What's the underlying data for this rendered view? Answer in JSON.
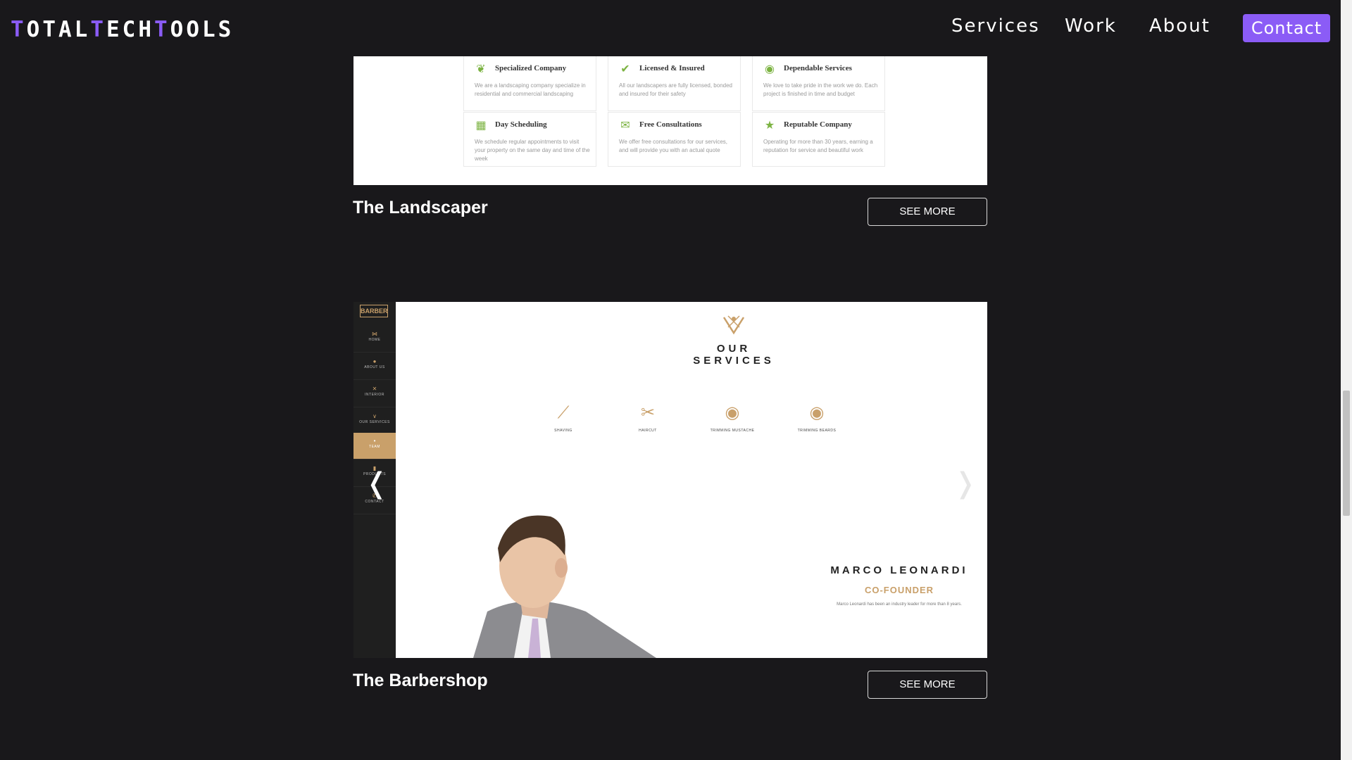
{
  "nav": {
    "logo_parts": [
      "T",
      "OTAL",
      "T",
      "ECH",
      "T",
      "OOLS"
    ],
    "links": [
      "Services",
      "Work",
      "About"
    ],
    "contact": "Contact"
  },
  "landscaper": {
    "features": [
      {
        "icon": "leaf-icon",
        "title": "Specialized Company",
        "desc": "We are a landscaping company specialize in residential and commercial landscaping"
      },
      {
        "icon": "check-circle-icon",
        "title": "Licensed & Insured",
        "desc": "All our landscapers are fully licensed, bonded and insured for their safety"
      },
      {
        "icon": "thumbs-up-icon",
        "title": "Dependable Services",
        "desc": "We love to take pride in the work we do. Each project is finished in time and budget"
      },
      {
        "icon": "calendar-icon",
        "title": "Day Scheduling",
        "desc": "We schedule regular appointments to visit your property on the same day and time of the week"
      },
      {
        "icon": "chat-bubbles-icon",
        "title": "Free Consultations",
        "desc": "We offer free consultations for our services, and will provide you with an actual quote"
      },
      {
        "icon": "trophy-icon",
        "title": "Reputable Company",
        "desc": "Operating for more than 30 years, earning a reputation for service and beautiful work"
      }
    ],
    "title": "The Landscaper",
    "button": "SEE MORE"
  },
  "barbershop": {
    "logo": "BARBER",
    "sidebar": [
      {
        "icon": "bow-tie-icon",
        "label": "HOME"
      },
      {
        "icon": "person-icon",
        "label": "ABOUT US"
      },
      {
        "icon": "scissors-icon",
        "label": "INTERIOR"
      },
      {
        "icon": "crest-icon",
        "label": "OUR SERVICES"
      },
      {
        "icon": "team-icon",
        "label": "TEAM"
      },
      {
        "icon": "bottle-icon",
        "label": "PRODUCTS"
      },
      {
        "icon": "phone-icon",
        "label": "CONTACT"
      }
    ],
    "heading": "OUR SERVICES",
    "services": [
      "SHAVING",
      "HAIRCUT",
      "TRIMMING MUSTACHE",
      "TRIMMING BEARDS"
    ],
    "member": {
      "name": "MARCO LEONARDI",
      "role": "CO-FOUNDER",
      "bio": "Marco Leonardi has been an industry leader for more than 8 years."
    },
    "title": "The Barbershop",
    "button": "SEE MORE"
  },
  "colors": {
    "accent": "#8b5cf6",
    "gold": "#c9a06a",
    "green": "#7cb342"
  }
}
